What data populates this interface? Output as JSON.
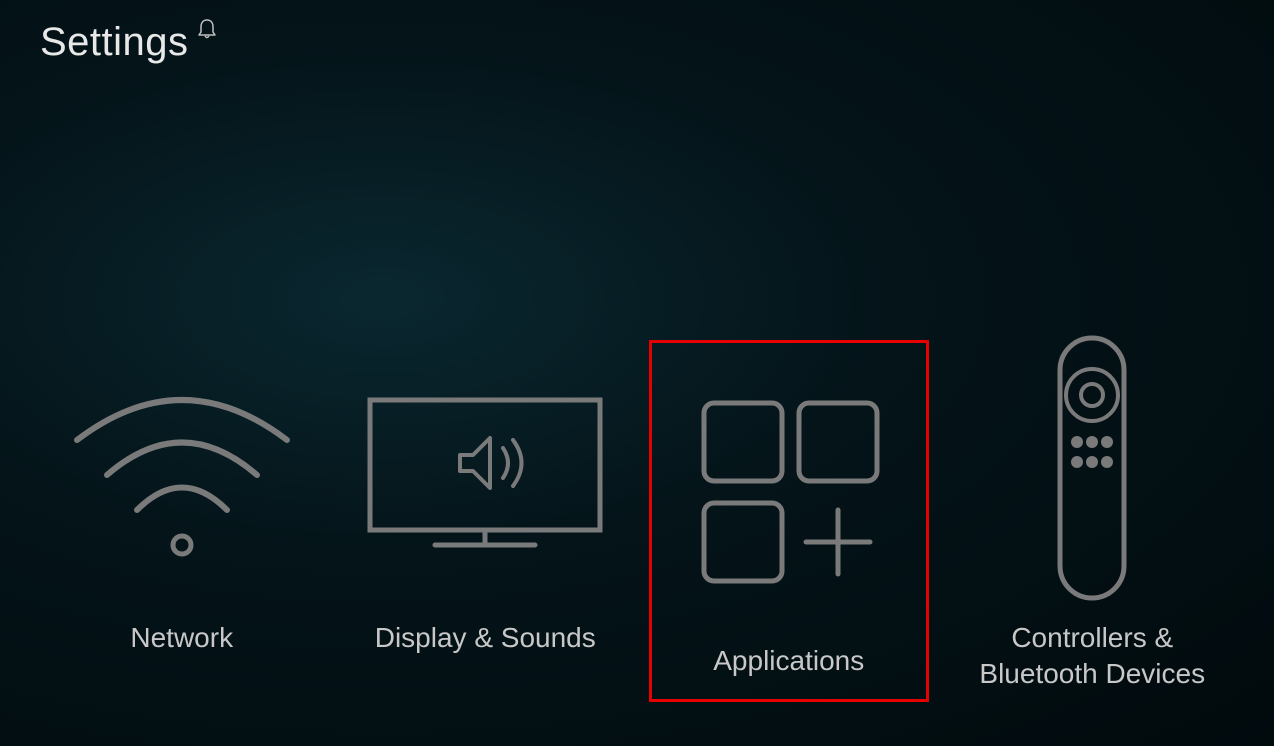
{
  "header": {
    "title": "Settings"
  },
  "tiles": {
    "network": {
      "label": "Network"
    },
    "display": {
      "label": "Display & Sounds"
    },
    "applications": {
      "label": "Applications"
    },
    "controllers": {
      "label": "Controllers & Bluetooth Devices"
    }
  }
}
